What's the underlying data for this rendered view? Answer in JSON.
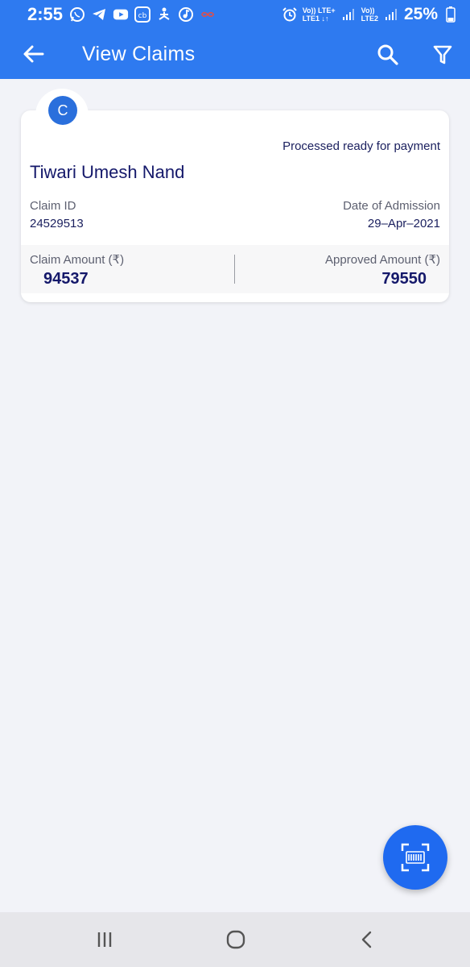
{
  "status_bar": {
    "time": "2:55",
    "left_icons": [
      "whatsapp-icon",
      "telegram-icon",
      "youtube-icon",
      "cb-app-icon",
      "yoga-app-icon",
      "music-app-icon",
      "infinity-icon"
    ],
    "cb_text": "cb",
    "sim1_top": "Vo)) LTE+",
    "sim1_bottom": "LTE1 ↓↑",
    "sim2_top": "Vo))",
    "sim2_bottom": "LTE2",
    "battery": "25%"
  },
  "app_bar": {
    "title": "View Claims",
    "icons": [
      "back-arrow-icon",
      "search-icon",
      "filter-icon"
    ]
  },
  "claim": {
    "avatar_letter": "C",
    "status": "Processed ready for payment",
    "name": "Tiwari Umesh Nand",
    "claim_id_label": "Claim ID",
    "claim_id": "24529513",
    "admission_label": "Date of Admission",
    "admission_date": "29–Apr–2021",
    "claim_amount_label": "Claim Amount (₹)",
    "claim_amount": "94537",
    "approved_amount_label": "Approved Amount (₹)",
    "approved_amount": "79550"
  },
  "fab": {
    "icon": "barcode-scan-icon"
  },
  "nav_bar": {
    "icons": [
      "recents-icon",
      "home-icon",
      "back-icon"
    ]
  },
  "colors": {
    "primary": "#2e7af0",
    "fab": "#1f6af0",
    "navy_text": "#14186a",
    "background": "#f2f3f8"
  }
}
